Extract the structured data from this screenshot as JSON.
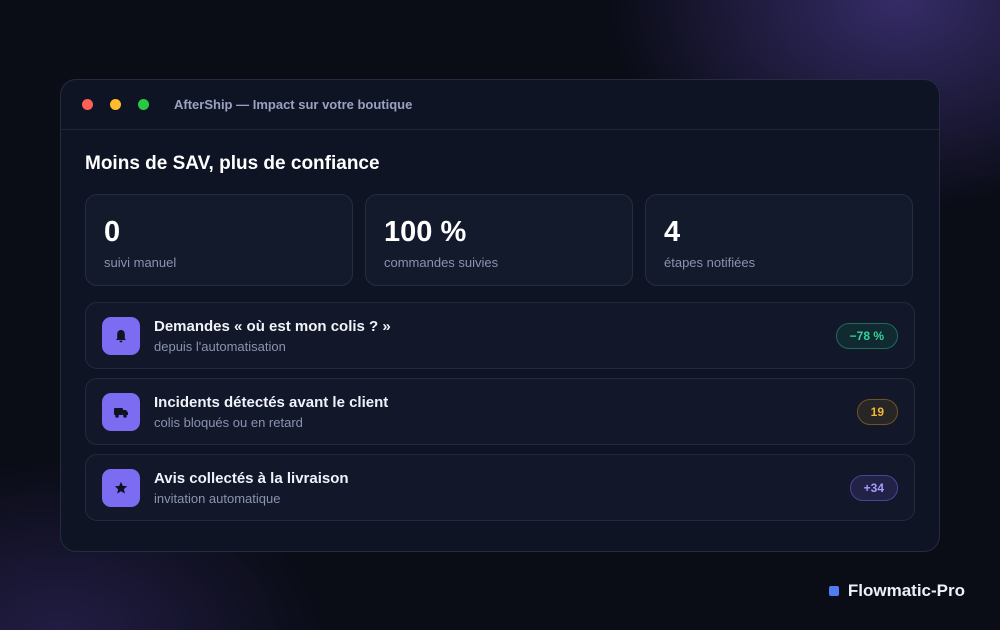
{
  "window": {
    "title": "AfterShip — Impact sur votre boutique"
  },
  "heading": "Moins de SAV, plus de confiance",
  "stats": [
    {
      "value": "0",
      "label": "suivi manuel"
    },
    {
      "value": "100 %",
      "label": "commandes suivies"
    },
    {
      "value": "4",
      "label": "étapes notifiées"
    }
  ],
  "rows": [
    {
      "icon": "bell-icon",
      "title": "Demandes « où est mon colis ? »",
      "subtitle": "depuis l'automatisation",
      "badge": "−78 %",
      "badge_color": "#34d399"
    },
    {
      "icon": "truck-icon",
      "title": "Incidents détectés avant le client",
      "subtitle": "colis bloqués ou en retard",
      "badge": "19",
      "badge_color": "#f5b63a"
    },
    {
      "icon": "star-icon",
      "title": "Avis collectés à la livraison",
      "subtitle": "invitation automatique",
      "badge": "+34",
      "badge_color": "#a99bff"
    }
  ],
  "brand": {
    "name": "Flowmatic-Pro",
    "mark_color": "#4f7cf0"
  },
  "colors": {
    "accent": "#7c6cf2",
    "background": "#0a0c16",
    "window": "#0f1424"
  }
}
